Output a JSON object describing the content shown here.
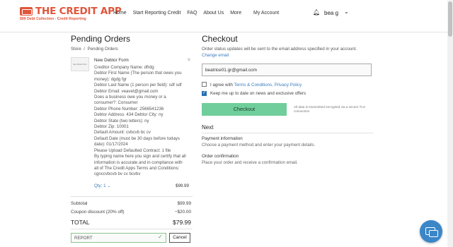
{
  "header": {
    "logo_text": "THE CREDIT APP",
    "logo_tagline": "$99 Debt Collection - Credit Reporting",
    "nav": [
      "Home",
      "Start Reporting Credit",
      "FAQ",
      "About Us",
      "More"
    ],
    "account_link": "My Account",
    "user_name": "bea g"
  },
  "cart": {
    "title": "Pending Orders",
    "breadcrumb": [
      "Store",
      "Pending Orders"
    ],
    "item": {
      "thumb_label": "New Debtor Form",
      "name": "New Debtor Form",
      "description": "Creditor Company Name: dfrdg\nDebtor First Name (The person that owes you money): dgdg fgr\nDebtor Last Name (1 person per field): sdf sdf\nDebtor Email: veavet@gmail.com\nDoes a business owe you money or a consumer?: Consumer\nDebtor Phone Number: 2566541236\nDebtor Address: 434  Debtor City: ny\nDebtor State (two letters): ny\nDebtor Zip: 10001\nDefault Amount: cvbcvb bc cv\nDefault Date (must be 30 days before todays date): 01/17/2024\nPlease Upload Defaulted Contract: 1 file\nBy typing name here you sign and certify that all information is accurate and in compliance with all of The Credit Apps Terms and Conditions: cgnccvbcvb bv cv bcvbv",
      "qty": "Qty: 1",
      "price": "$99.99"
    },
    "subtotal_label": "Subtotal",
    "subtotal_value": "$99.99",
    "coupon_label": "Coupon discount (20% off)",
    "coupon_value": "−$20.00",
    "total_label": "TOTAL",
    "total_value": "$79.99",
    "coupon_code": "REPORT",
    "cancel_label": "Cancel"
  },
  "checkout": {
    "title": "Checkout",
    "note": "Order status updates will be sent to the email address specified in your account.",
    "change_email": "Change email",
    "email_value": "beatrice01.gr@gmail.com",
    "terms_prefix": "I agree with",
    "terms_link": "Terms & Conditions, Privacy Policy",
    "terms_checked": false,
    "news_label": "Keep me up to date on news and exclusive offers",
    "news_checked": true,
    "button_label": "Checkout",
    "secure_note": "All data is transmitted encrypted via a secure TLS connection",
    "next_heading": "Next",
    "steps": [
      {
        "title": "Payment information",
        "desc": "Choose a payment method and enter your payment details."
      },
      {
        "title": "Order confirmation",
        "desc": "Place your order and receive a confirmation email."
      }
    ]
  },
  "colors": {
    "brand": "#e0553a",
    "link": "#3b7bbf",
    "checkout_button": "#6fce9b",
    "chat": "#3a86c8"
  }
}
